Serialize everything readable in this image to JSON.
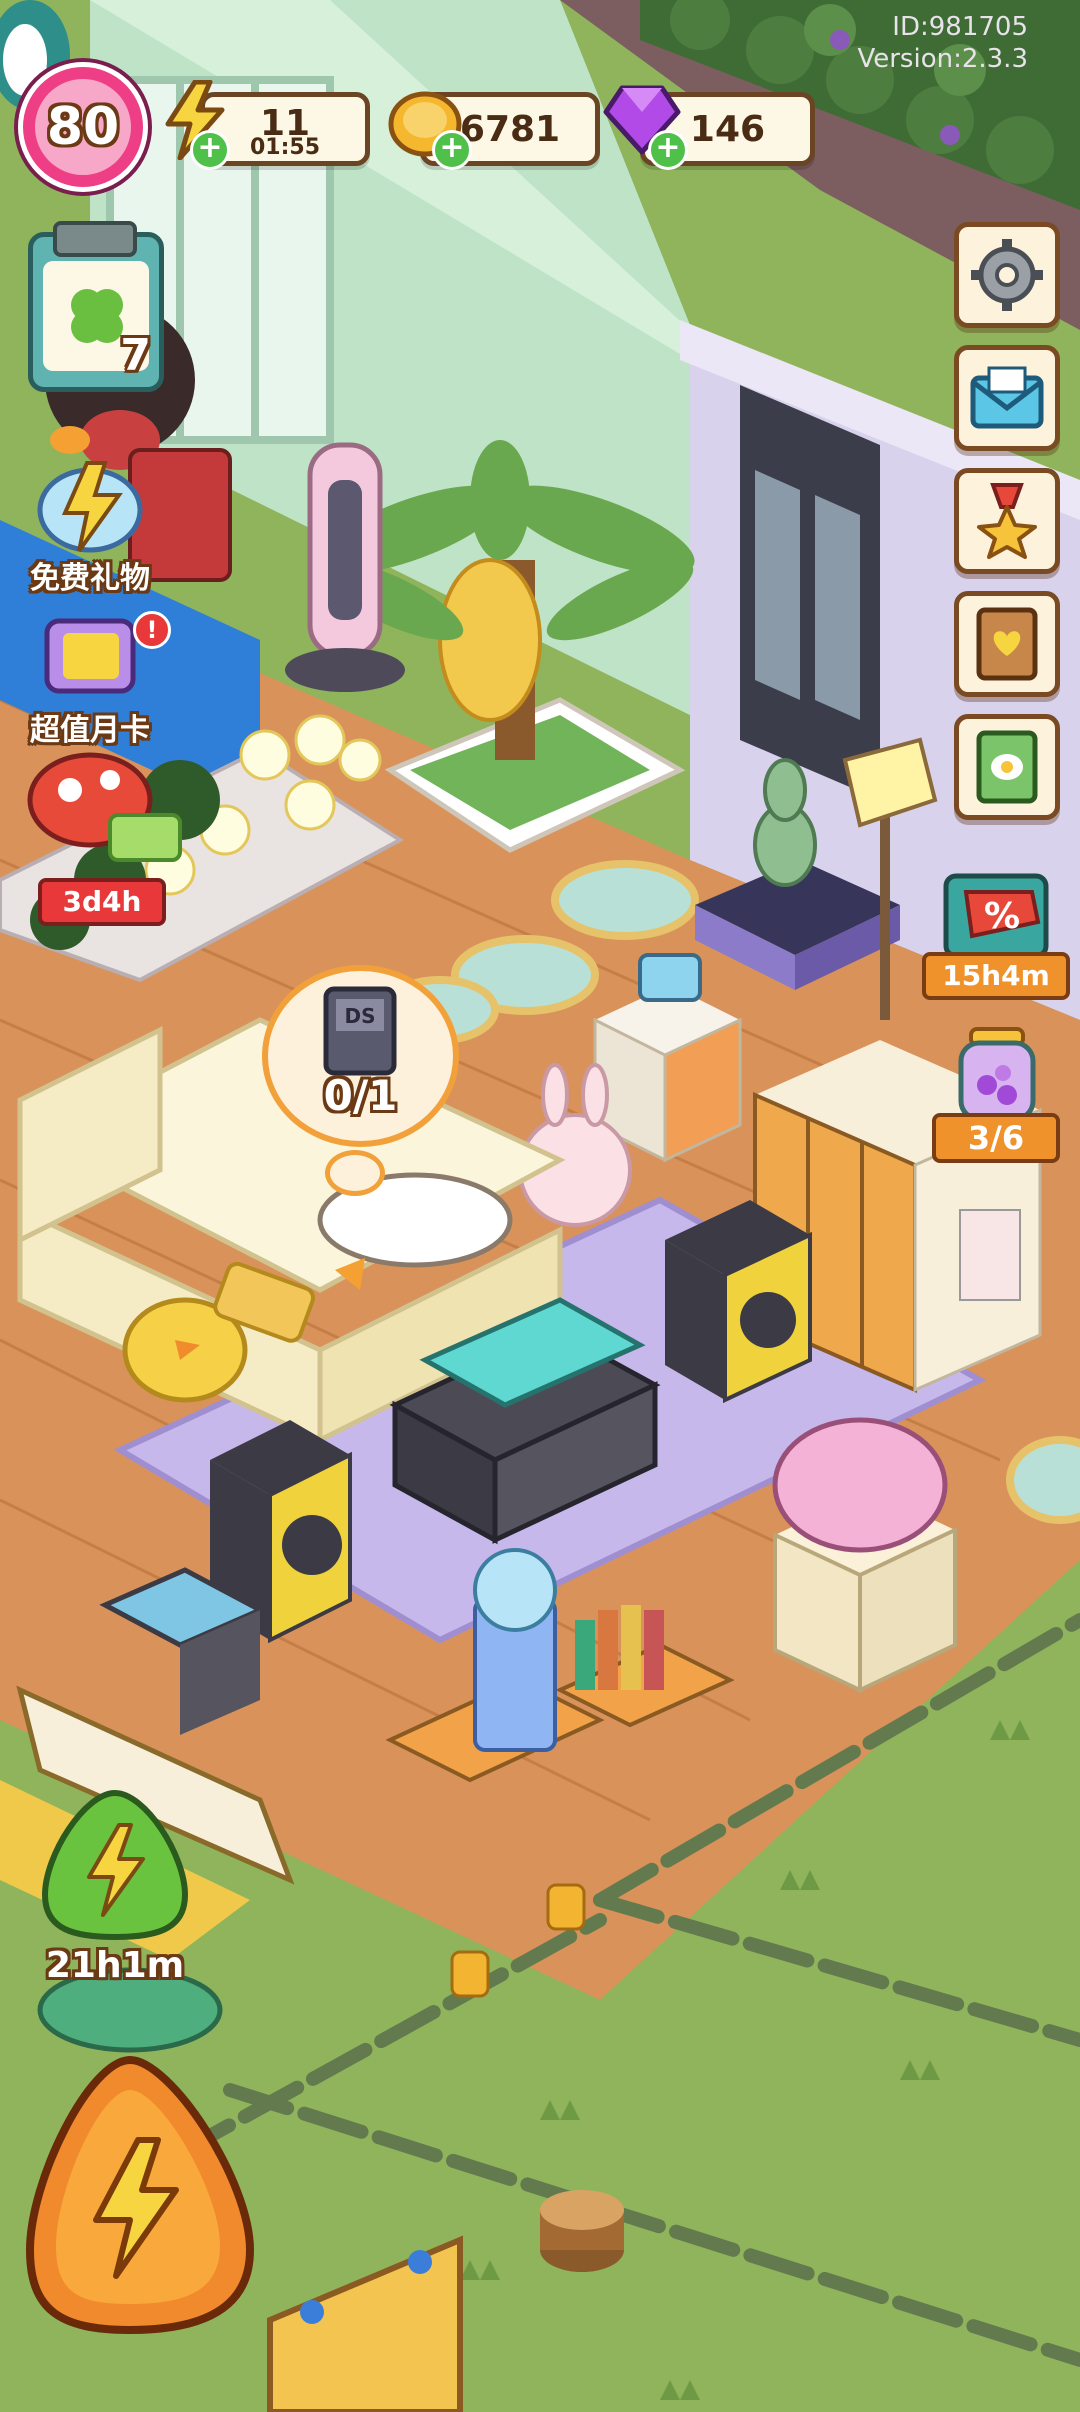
{
  "account": {
    "id_text": "ID:981705",
    "version_text": "Version:2.3.3"
  },
  "player": {
    "level": "80"
  },
  "resources": {
    "energy": {
      "value": "11",
      "timer": "01:55",
      "icon": "lightning-bolt-icon"
    },
    "coins": {
      "value": "6781",
      "icon": "gold-coin-icon"
    },
    "gems": {
      "value": "146",
      "icon": "purple-gem-icon"
    }
  },
  "left_menu": {
    "clipboard_count": "7",
    "free_gift_label": "免费礼物",
    "monthly_card_label": "超值月卡",
    "mushroom_timer": "3d4h"
  },
  "right_menu": {
    "sale_timer": "15h4m",
    "jar_progress": "3/6",
    "buttons": [
      "settings-gear-icon",
      "mail-envelope-icon",
      "medal-star-icon",
      "heart-book-icon",
      "recipe-book-icon"
    ]
  },
  "scene": {
    "task_bubble_count": "0/1",
    "task_item_label": "DS"
  },
  "bottom_left": {
    "energy_timer": "21h1m"
  },
  "colors": {
    "lawn": "#8fb45c",
    "wall_green": "#bfe3c6",
    "wall_purple": "#d9d2ec",
    "floor": "#d9935a",
    "rug": "#c7b8ec",
    "level_ring": "#ee3f86",
    "ui_outline": "#6b4423"
  }
}
